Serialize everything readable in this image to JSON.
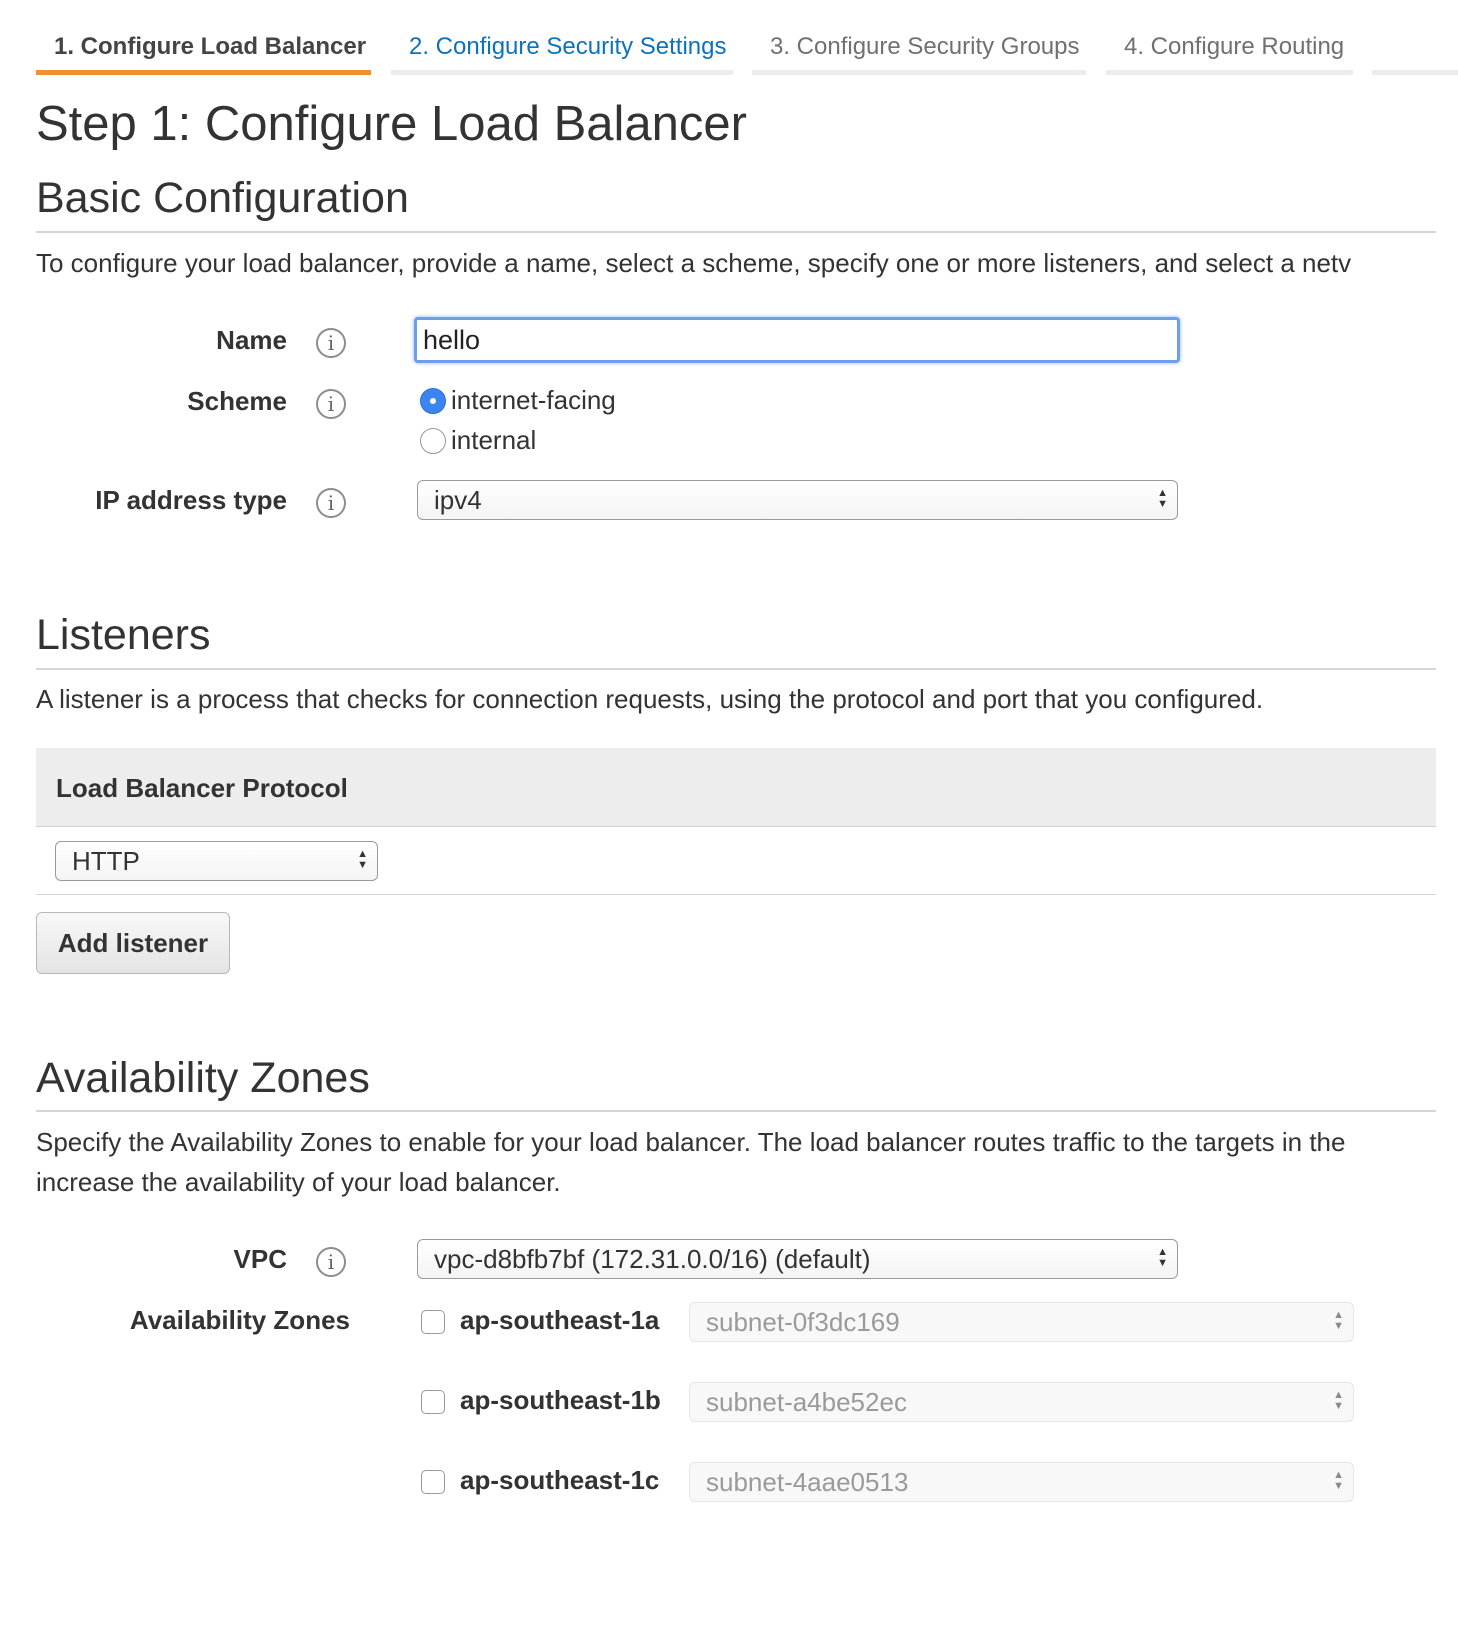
{
  "tabs": [
    {
      "label": "1. Configure Load Balancer",
      "state": "active"
    },
    {
      "label": "2. Configure Security Settings",
      "state": "link"
    },
    {
      "label": "3. Configure Security Groups",
      "state": "muted"
    },
    {
      "label": "4. Configure Routing",
      "state": "muted"
    }
  ],
  "page_title": "Step 1: Configure Load Balancer",
  "basic": {
    "title": "Basic Configuration",
    "description": "To configure your load balancer, provide a name, select a scheme, specify one or more listeners, and select a netv",
    "name_label": "Name",
    "name_value": "hello",
    "scheme_label": "Scheme",
    "scheme_options": [
      {
        "label": "internet-facing",
        "checked": true
      },
      {
        "label": "internal",
        "checked": false
      }
    ],
    "ip_label": "IP address type",
    "ip_value": "ipv4"
  },
  "listeners": {
    "title": "Listeners",
    "description": "A listener is a process that checks for connection requests, using the protocol and port that you configured.",
    "column_header": "Load Balancer Protocol",
    "protocol_value": "HTTP",
    "add_button": "Add listener"
  },
  "availability": {
    "title": "Availability Zones",
    "description_line1": "Specify the Availability Zones to enable for your load balancer. The load balancer routes traffic to the targets in the",
    "description_line2": "increase the availability of your load balancer.",
    "vpc_label": "VPC",
    "vpc_value": "vpc-d8bfb7bf (172.31.0.0/16) (default)",
    "zones_label": "Availability Zones",
    "zones": [
      {
        "name": "ap-southeast-1a",
        "subnet": "subnet-0f3dc169",
        "checked": false
      },
      {
        "name": "ap-southeast-1b",
        "subnet": "subnet-a4be52ec",
        "checked": false
      },
      {
        "name": "ap-southeast-1c",
        "subnet": "subnet-4aae0513",
        "checked": false
      }
    ]
  },
  "icons": {
    "info": "info-icon",
    "select_arrows": "up-down-arrows-icon",
    "info_glyph": "i",
    "arrows_glyph": "▲▼"
  },
  "colors": {
    "accent": "#f0912d",
    "link": "#0b73bb",
    "radio_selected": "#3a85f0",
    "focus": "#6c9eea"
  }
}
